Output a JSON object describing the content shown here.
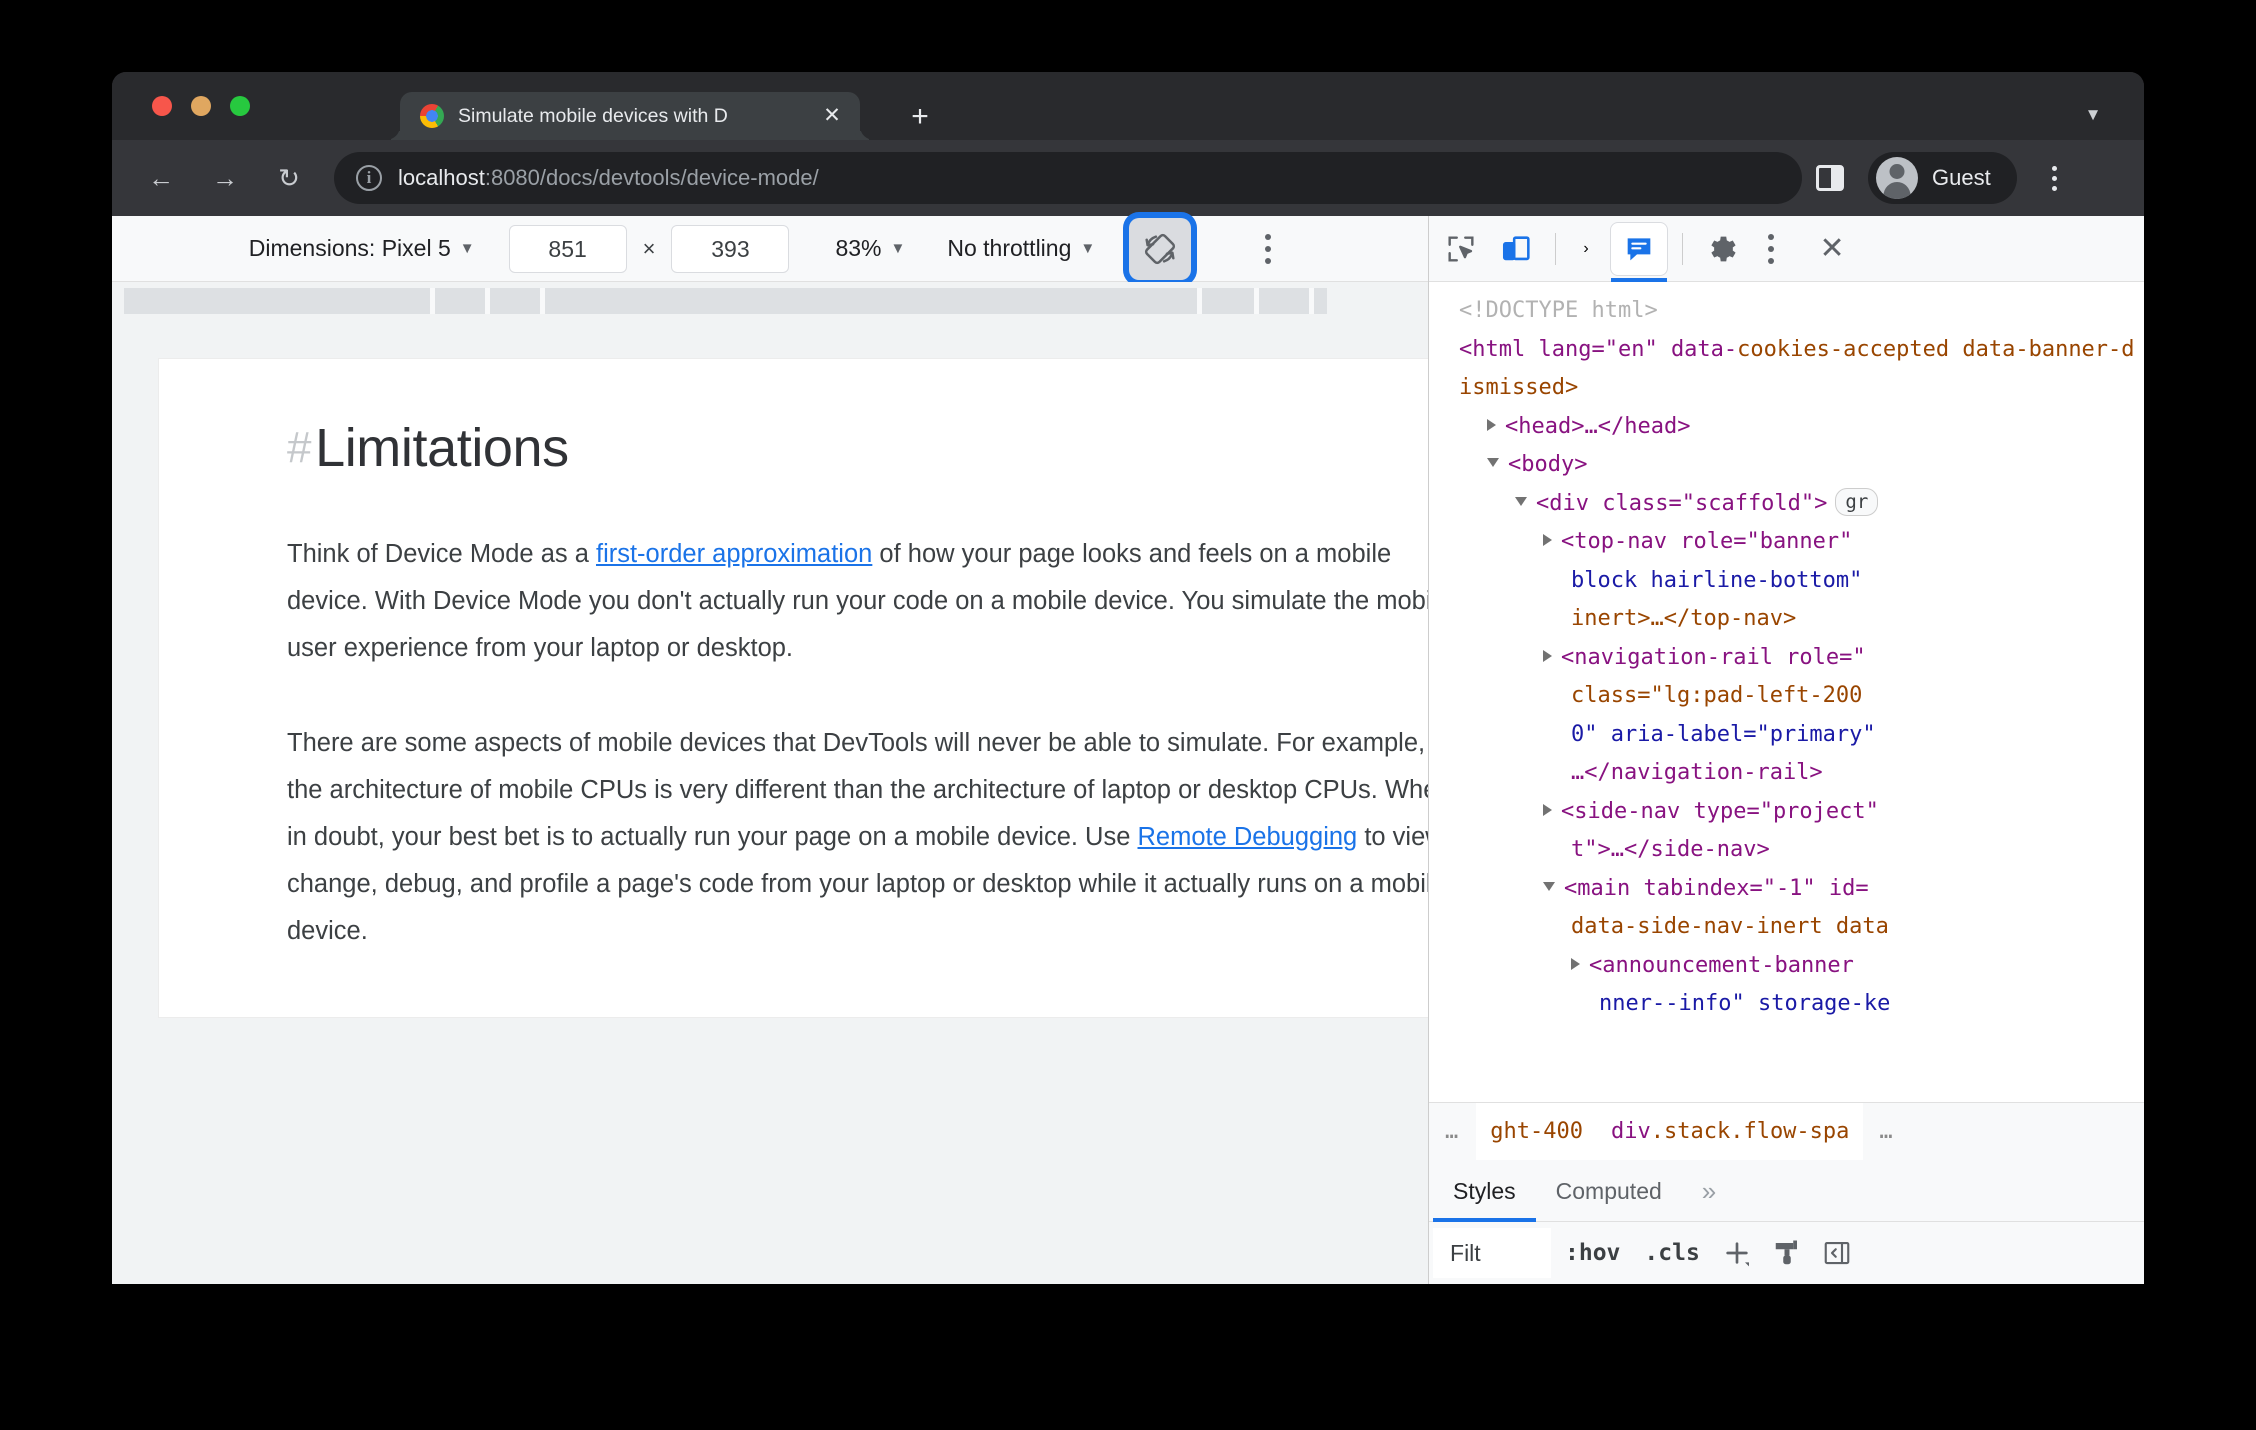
{
  "browser": {
    "tab": {
      "title": "Simulate mobile devices with D",
      "close_label": "✕"
    },
    "new_tab_label": "+",
    "window_chevron": "▼",
    "nav": {
      "back": "←",
      "forward": "→",
      "reload": "↻"
    },
    "omnibox": {
      "host": "localhost",
      "rest": ":8080/docs/devtools/device-mode/"
    },
    "profile_name": "Guest",
    "colors": {
      "traffic_red": "#f7564b",
      "traffic_amber": "#e0a760",
      "traffic_green": "#27c93f"
    }
  },
  "device_mode": {
    "dimensions_label": "Dimensions: Pixel 5",
    "dimensions_caret": "▼",
    "width": "851",
    "height": "393",
    "multiply": "×",
    "zoom": "83%",
    "zoom_caret": "▼",
    "throttling": "No throttling",
    "throttling_caret": "▼",
    "rotate_icon_name": "rotate-icon",
    "kebab_label": "More options",
    "focus_ring_color": "#1a73e8"
  },
  "page": {
    "heading_hash": "#",
    "heading": "Limitations",
    "paragraph1_a": "Think of Device Mode as a ",
    "paragraph1_link": "first-order approximation",
    "paragraph1_b": " of how your page looks and feels on a mobile device. With Device Mode you don't actually run your code on a mobile device. You simulate the mobile user experience from your laptop or desktop.",
    "paragraph2_a": "There are some aspects of mobile devices that DevTools will never be able to simulate. For example, the architecture of mobile CPUs is very different than the architecture of laptop or desktop CPUs. When in doubt, your best bet is to actually run your page on a mobile device. Use ",
    "paragraph2_link": "Remote Debugging",
    "paragraph2_b": " to view, change, debug, and profile a page's code from your laptop or desktop while it actually runs on a mobile device."
  },
  "devtools": {
    "toolbar": {
      "inspect": "inspect-icon",
      "device_toggle": "device-toggle-icon",
      "chevron": "›",
      "ai_assistant": "ai-assistant-icon",
      "settings": "gear-icon",
      "more": "kebab-icon",
      "close": "✕"
    },
    "dom": {
      "doctype": "<!DOCTYPE html>",
      "line_html_1": "<html lang=\"en\" data-",
      "line_html_2": "cookies-accepted data-",
      "line_html_3": "banner-dismissed>",
      "line_head": "<head>…</head>",
      "line_body": "<body>",
      "line_div_scaffold": "<div class=\"scaffold\">",
      "badge_scaffold": "gr",
      "line_topnav_1": "<top-nav role=\"banner\"",
      "line_topnav_2": "block hairline-bottom\"",
      "line_topnav_3": "inert>…</top-nav>",
      "line_navrail_1": "<navigation-rail role=\"",
      "line_navrail_2": "class=\"lg:pad-left-200 ",
      "line_navrail_3": "0\" aria-label=\"primary\"",
      "line_navrail_4": "…</navigation-rail>",
      "line_sidenav_1": "<side-nav type=\"project\"",
      "line_sidenav_2": "t\">…</side-nav>",
      "line_main_1": "<main tabindex=\"-1\" id=",
      "line_main_2": "data-side-nav-inert data",
      "line_banner_1": "<announcement-banner ",
      "line_banner_2": "nner--info\" storage-ke"
    },
    "breadcrumb": {
      "left_ellipsis": "…",
      "crumb1": "ght-400",
      "crumb2_tag": "div",
      "crumb2_classes": ".stack.flow-spa",
      "right_ellipsis": "…"
    },
    "styles": {
      "tabs": [
        {
          "label": "Styles",
          "active": true
        },
        {
          "label": "Computed",
          "active": false
        }
      ],
      "overflow": "»",
      "filter_value": "Filt",
      "filter_placeholder": "Filter",
      "hov": ":hov",
      "cls": ".cls",
      "new_rule": "+",
      "copy_icon": "paintbrush-icon",
      "sidebar_toggle": "sidebar-toggle-icon"
    }
  }
}
